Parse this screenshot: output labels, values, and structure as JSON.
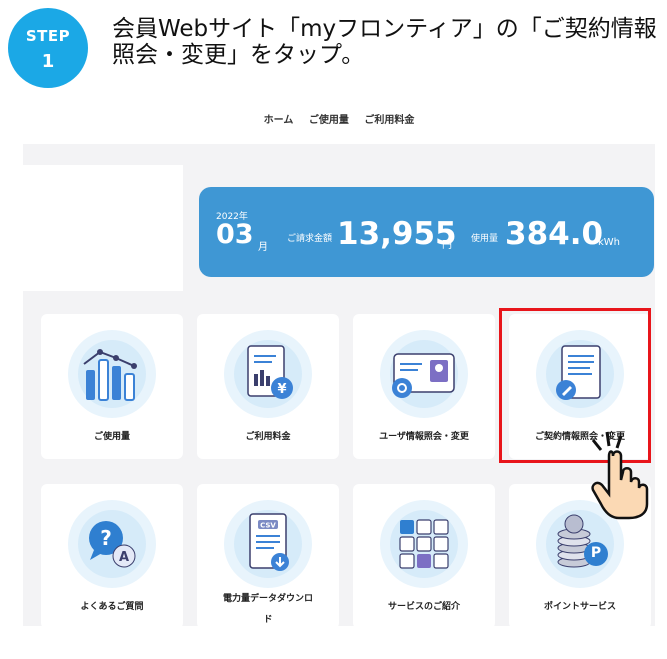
{
  "step": {
    "word": "STEP",
    "number": "1"
  },
  "instruction": "会員Webサイト「myフロンティア」の「ご契約情報照会・変更」をタップ。",
  "nav": {
    "items": [
      "ホーム",
      "ご使用量",
      "ご利用料金"
    ]
  },
  "summary": {
    "year": "2022年",
    "month": "03",
    "month_unit": "月",
    "bill_label": "ご請求金額",
    "bill_value": "13,955",
    "bill_unit": "円",
    "usage_label": "使用量",
    "usage_value": "384.0",
    "usage_unit": "kWh"
  },
  "menu": [
    {
      "label": "ご使用量",
      "icon": "bar-chart-icon"
    },
    {
      "label": "ご利用料金",
      "icon": "invoice-yen-icon"
    },
    {
      "label": "ユーザ情報照会・変更",
      "icon": "id-card-icon"
    },
    {
      "label": "ご契約情報照会・変更",
      "icon": "document-edit-icon"
    },
    {
      "label": "よくあるご質問",
      "icon": "question-chat-icon"
    },
    {
      "label_line1": "電力量データダウンロ",
      "label_line2": "ド",
      "icon": "csv-download-icon"
    },
    {
      "label": "サービスのご紹介",
      "icon": "service-grid-icon"
    },
    {
      "label": "ポイントサービス",
      "icon": "point-coins-icon",
      "badge": "P"
    }
  ],
  "colors": {
    "step": "#1ba8e6",
    "summary": "#3f97d4",
    "highlight": "#e8151b"
  }
}
